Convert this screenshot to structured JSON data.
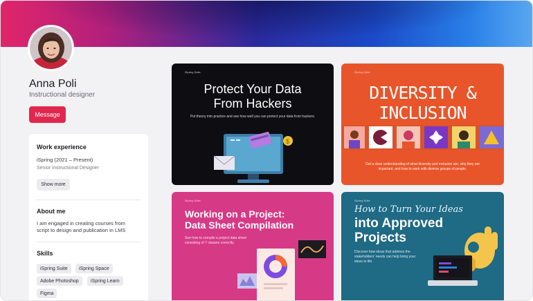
{
  "profile": {
    "name": "Anna Poli",
    "role": "Instructional designer",
    "message_label": "Message"
  },
  "work": {
    "title": "Work experience",
    "company": "iSpring (2021 – Present)",
    "position": "Senior Instructional Designer",
    "show_more": "Show more"
  },
  "about": {
    "title": "About me",
    "text": "I am engaged in creating courses from script to design and publication in LMS"
  },
  "skills": {
    "title": "Skills",
    "items": [
      "iSpring Suite",
      "iSpring Space",
      "Adobe Photoshop",
      "iSpring Learn",
      "Figma"
    ]
  },
  "portfolio": [
    {
      "tag": "iSpring Suite",
      "title_line1": "Protect Your Data",
      "title_line2": "From Hackers",
      "subtitle": "Put theory into practice and see how well you can protect your data from hackers."
    },
    {
      "tag": "iSpring Suite",
      "title_left": "DIVERSITY",
      "title_amp": "&",
      "title_right": "INCLUSION",
      "subtitle": "Get a clear understanding of what diversity and inclusion are, why they are important, and how to work with diverse groups of people."
    },
    {
      "tag": "iSpring Suite",
      "title_line1": "Working on a Project:",
      "title_line2": "Data Sheet Compilation",
      "subtitle": "See how to compile a project data sheet consisting of 7 clauses correctly."
    },
    {
      "tag": "iSpring Suite",
      "script": "How to Turn Your Ideas",
      "title_line1": "into Approved",
      "title_line2": "Projects",
      "subtitle": "Discover how ideas that address the stakeholders' needs can help bring your ideas to life."
    }
  ],
  "colors": {
    "accent": "#e2274f",
    "tile_dark": "#0e0e12",
    "tile_orange": "#e8552a",
    "tile_pink": "#d63a87",
    "tile_teal": "#1f6a84"
  }
}
